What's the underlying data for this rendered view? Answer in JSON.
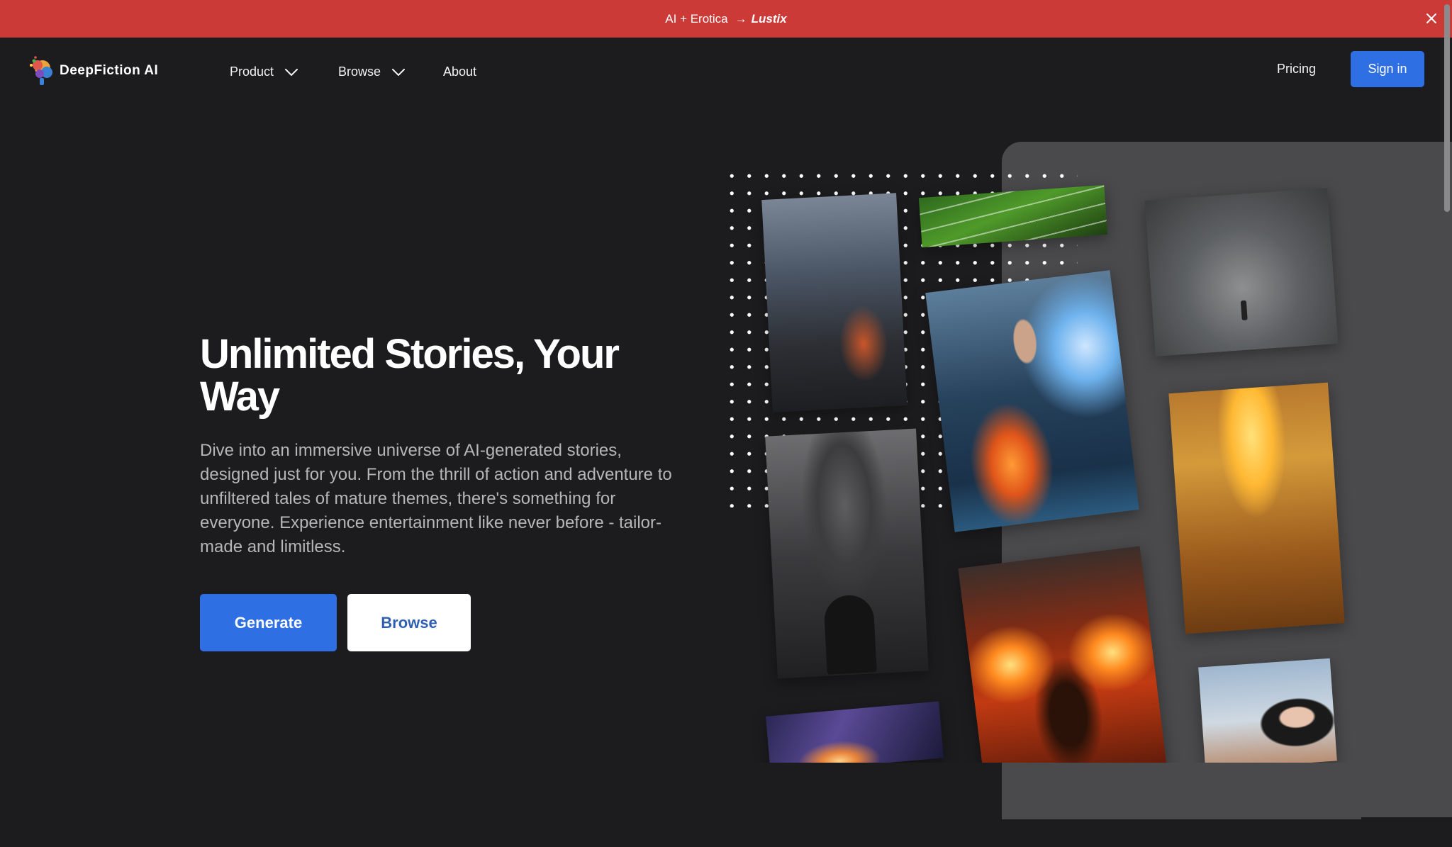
{
  "banner": {
    "text": "AI + Erotica",
    "arrow": "→",
    "brand": "Lustix",
    "close_icon": "close-icon"
  },
  "nav": {
    "logo_text": "DeepFiction AI",
    "product_label": "Product",
    "browse_label": "Browse",
    "about_label": "About",
    "pricing_label": "Pricing",
    "signin_label": "Sign in"
  },
  "hero": {
    "title": "Unlimited Stories, Your Way",
    "description": "Dive into an immersive universe of AI-generated stories, designed just for you. From the thrill of action and adventure to unfiltered tales of mature themes, there's something for everyone. Experience entertainment like never before - tailor-made and limitless.",
    "generate_label": "Generate",
    "browse_label": "Browse"
  },
  "colors": {
    "banner": "#cb3a36",
    "background": "#1c1c1e",
    "accent": "#2f6fe4",
    "panel": "#4a4a4c"
  }
}
